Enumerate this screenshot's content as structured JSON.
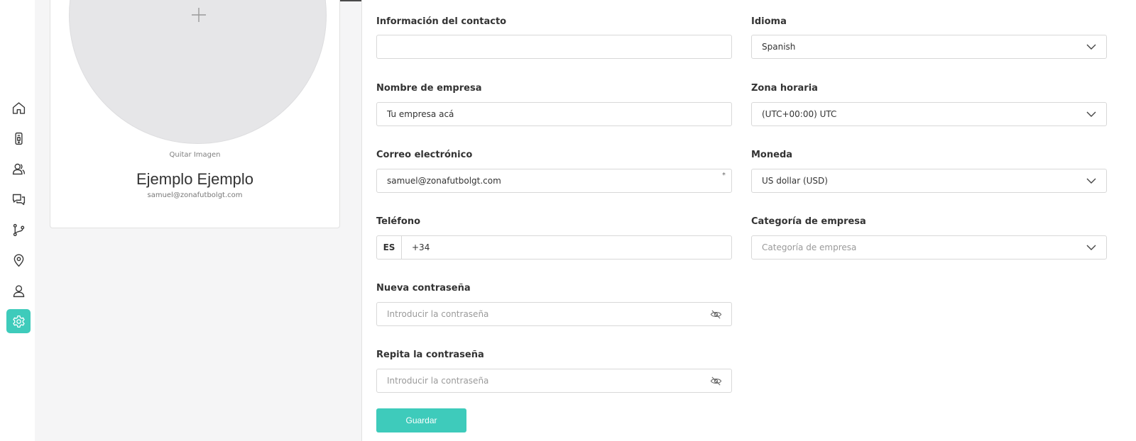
{
  "colors": {
    "accent": "#3ecbbb",
    "icon": "#3a3a3a"
  },
  "sidebar": {
    "items": [
      {
        "icon": "home-icon",
        "active": false
      },
      {
        "icon": "mobile-icon",
        "active": false
      },
      {
        "icon": "users-icon",
        "active": false
      },
      {
        "icon": "chat-icon",
        "active": false
      },
      {
        "icon": "git-branch-icon",
        "active": false
      },
      {
        "icon": "location-pin-icon",
        "active": false
      },
      {
        "icon": "user-icon",
        "active": false
      },
      {
        "icon": "gear-icon",
        "active": true
      }
    ]
  },
  "profile": {
    "add_image_icon": "plus-icon",
    "remove_image": "Quitar Imagen",
    "name": "Ejemplo Ejemplo",
    "email": "samuel@zonafutbolgt.com"
  },
  "form": {
    "contact_info": {
      "label": "Información del contacto",
      "value": ""
    },
    "company_name": {
      "label": "Nombre de empresa",
      "value": "Tu empresa acá"
    },
    "email": {
      "label": "Correo electrónico",
      "value": "samuel@zonafutbolgt.com",
      "required_mark": "*"
    },
    "phone": {
      "label": "Teléfono",
      "country": "ES",
      "value": "+34"
    },
    "new_password": {
      "label": "Nueva contraseña",
      "placeholder": "Introducir la contraseña"
    },
    "repeat_password": {
      "label": "Repita la contraseña",
      "placeholder": "Introducir la contraseña"
    },
    "language": {
      "label": "Idioma",
      "value": "Spanish"
    },
    "timezone": {
      "label": "Zona horaria",
      "value": "(UTC+00:00) UTC"
    },
    "currency": {
      "label": "Moneda",
      "value": "US dollar (USD)"
    },
    "category": {
      "label": "Categoría de empresa",
      "placeholder": "Categoría de empresa"
    },
    "save_label": "Guardar"
  }
}
